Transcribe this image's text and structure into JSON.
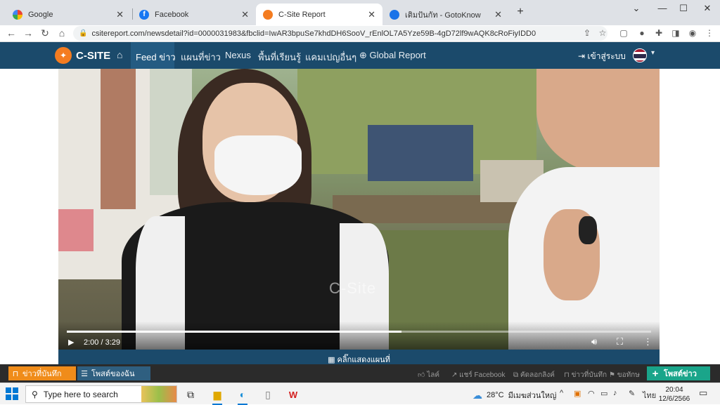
{
  "tabs": [
    {
      "title": "Google",
      "fav_color": "#ea4335"
    },
    {
      "title": "Facebook",
      "fav_color": "#1877f2"
    },
    {
      "title": "C-Site Report",
      "fav_color": "#f47c20"
    },
    {
      "title": "เติมปันกัท - GotoKnow",
      "fav_color": "#1a73e8"
    }
  ],
  "address": {
    "url": "csitereport.com/newsdetail?id=0000031983&fbclid=IwAR3bpuSe7khdDH6SooV_rEnlOL7A5Yze59B-4gD72lf9wAQK8cRoFiyIDD0"
  },
  "site": {
    "brand": "C-SITE",
    "nav": [
      "Feed ข่าว",
      "แผนที่ข่าว",
      "Nexus",
      "พื้นที่เรียนรู้",
      "แคมเปญอื่นๆ",
      "Global Report"
    ],
    "login": "เข้าสู่ระบบ",
    "colors": {
      "nav_bg": "#1b4a6b",
      "accent": "#f47c20",
      "post": "#1aa58a"
    }
  },
  "video": {
    "time": "2:00 / 3:29",
    "progress": 0.573,
    "watermark": "C-Site"
  },
  "map_button": "คลิ๊กแสดงแผนที่",
  "bottom_bar": {
    "bookmarked": "ข่าวที่บันทึก",
    "my_posts": "โพสต์ของฉัน",
    "actions": [
      "ไลค์",
      "แชร์ Facebook",
      "คัดลอกลิงค์",
      "ข่าวที่บันทึก",
      "ขอทักษ"
    ],
    "post_news": "โพสต์ข่าว"
  },
  "taskbar": {
    "search_placeholder": "Type here to search",
    "weather": "28°C",
    "weather_desc": "มีเมฆส่วนใหญ่",
    "lang": "ไทย",
    "time": "20:04",
    "date": "12/6/2566"
  }
}
